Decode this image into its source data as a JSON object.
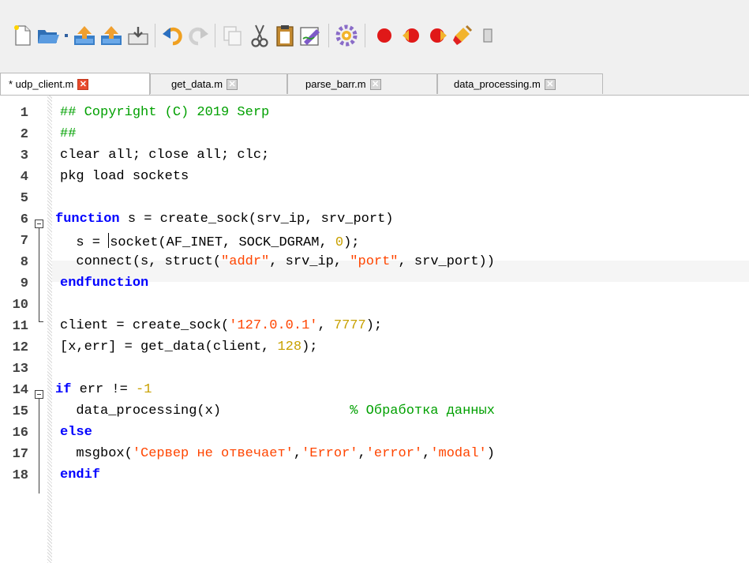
{
  "toolbar": {
    "icons": [
      "new-file-icon",
      "open-folder-icon",
      "upload-icon",
      "upload-icon-2",
      "save-icon",
      "undo-icon",
      "redo-icon",
      "copy-icon",
      "cut-icon",
      "paste-icon",
      "edit-icon",
      "run-gear-icon",
      "breakpoint-icon",
      "step-back-icon",
      "step-forward-icon",
      "clear-icon",
      "more-icon"
    ]
  },
  "tabs": [
    {
      "label": "* udp_client.m",
      "active": true
    },
    {
      "label": "get_data.m",
      "active": false
    },
    {
      "label": "parse_barr.m",
      "active": false
    },
    {
      "label": "data_processing.m",
      "active": false
    }
  ],
  "editor": {
    "line_numbers": [
      "1",
      "2",
      "3",
      "4",
      "5",
      "6",
      "7",
      "8",
      "9",
      "10",
      "11",
      "12",
      "13",
      "14",
      "15",
      "16",
      "17",
      "18"
    ],
    "code": {
      "l1": "## Copyright (C) 2019 Serp",
      "l2": "##",
      "l3": "clear all; close all; clc;",
      "l4": "pkg load sockets",
      "l6_kw": "function",
      "l6_rest": " s = create_sock(srv_ip, srv_port)",
      "l7_a": "  s = ",
      "l7_b": "socket(AF_INET, SOCK_DGRAM, ",
      "l7_num": "0",
      "l7_c": ");",
      "l8_a": "  connect(s, struct(",
      "l8_s1": "\"addr\"",
      "l8_b": ", srv_ip, ",
      "l8_s2": "\"port\"",
      "l8_c": ", srv_port))",
      "l9": "endfunction",
      "l11_a": "client = create_sock(",
      "l11_s": "'127.0.0.1'",
      "l11_b": ", ",
      "l11_n": "7777",
      "l11_c": ");",
      "l12_a": "[x,err] = get_data(client, ",
      "l12_n": "128",
      "l12_c": ");",
      "l14_kw": "if",
      "l14_a": " err != ",
      "l14_n": "-1",
      "l15_a": "  data_processing(x)",
      "l15_gap": "                ",
      "l15_c": "% Обработка данных",
      "l16": "else",
      "l17_a": "  msgbox(",
      "l17_s1": "'Сервер не отвечает'",
      "l17_s2": "'Error'",
      "l17_s3": "'error'",
      "l17_s4": "'modal'",
      "l17_comma": ",",
      "l17_end": ")",
      "l18": "endif"
    }
  },
  "colors": {
    "keyword": "#0000ff",
    "comment": "#00a000",
    "string": "#ff4500",
    "number": "#c8a000",
    "tab_close_active": "#e84a2c"
  }
}
